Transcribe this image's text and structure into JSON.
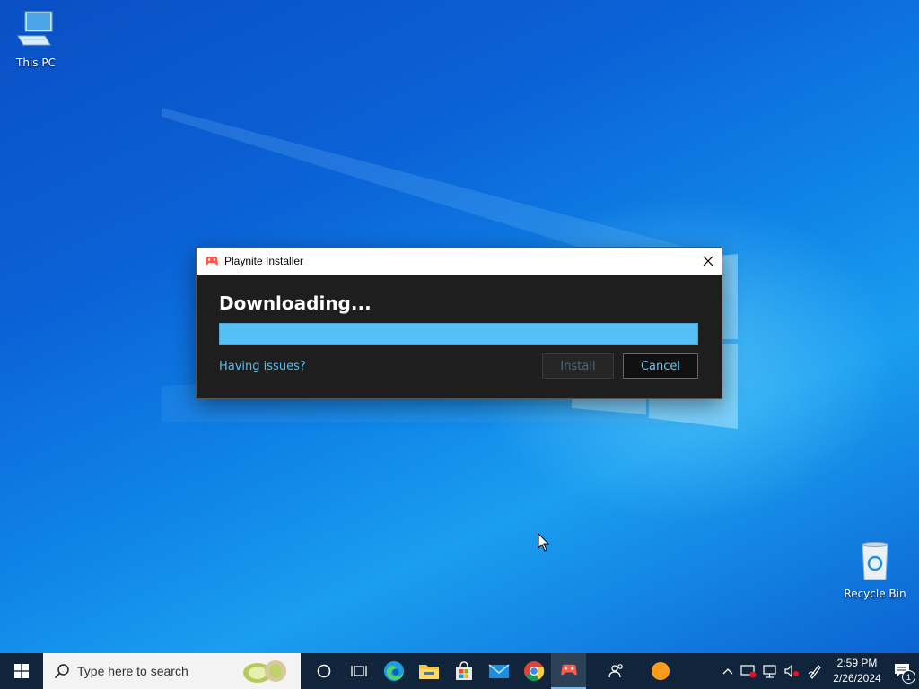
{
  "desktop": {
    "icons": [
      {
        "label": "This PC"
      },
      {
        "label": "Recycle Bin"
      }
    ]
  },
  "window": {
    "title": "Playnite Installer",
    "heading": "Downloading...",
    "progress_percent": 100,
    "issues_link": "Having issues?",
    "install_label": "Install",
    "cancel_label": "Cancel"
  },
  "taskbar": {
    "search_placeholder": "Type here to search",
    "apps": [
      "cortana-icon",
      "task-view-icon",
      "edge-icon",
      "file-explorer-icon",
      "store-icon",
      "mail-icon",
      "chrome-icon",
      "playnite-icon",
      "people-icon",
      "orange-app-icon"
    ],
    "clock_time": "2:59 PM",
    "clock_date": "2/26/2024",
    "notification_count": "1"
  },
  "colors": {
    "accent": "#55c0f5",
    "link": "#4fc0f8",
    "taskbar": "#10243b",
    "window_bg": "#1e1e1e"
  }
}
